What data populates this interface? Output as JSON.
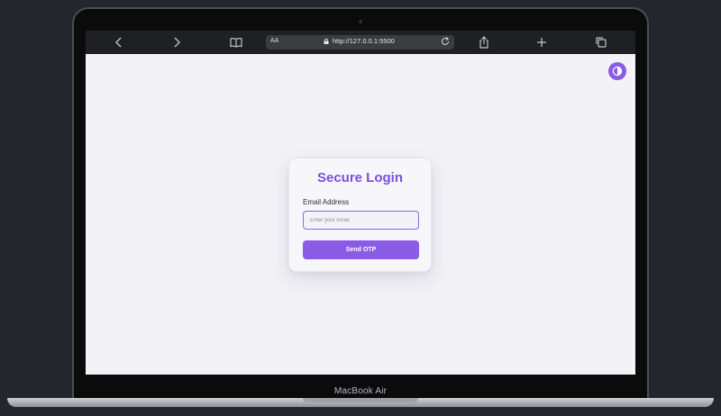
{
  "device": {
    "model_label": "MacBook Air"
  },
  "browser": {
    "text_size_label": "AA",
    "url": "http://127.0.0.1:5500",
    "icons": {
      "back": "chevron-left-icon",
      "forward": "chevron-right-icon",
      "bookmarks": "book-icon",
      "lock": "lock-icon",
      "reload": "reload-icon",
      "share": "share-icon",
      "new_tab": "plus-icon",
      "tabs": "tabs-icon"
    }
  },
  "page": {
    "theme_toggle_icon": "theme-toggle-icon",
    "login": {
      "title": "Secure Login",
      "email_label": "Email Address",
      "email_placeholder": "Enter your email",
      "email_value": "",
      "submit_label": "Send OTP"
    }
  },
  "colors": {
    "accent": "#8a5be6",
    "title": "#7c4ddc",
    "page_background": "#f2f2f7",
    "toolbar": "#1f2023"
  }
}
